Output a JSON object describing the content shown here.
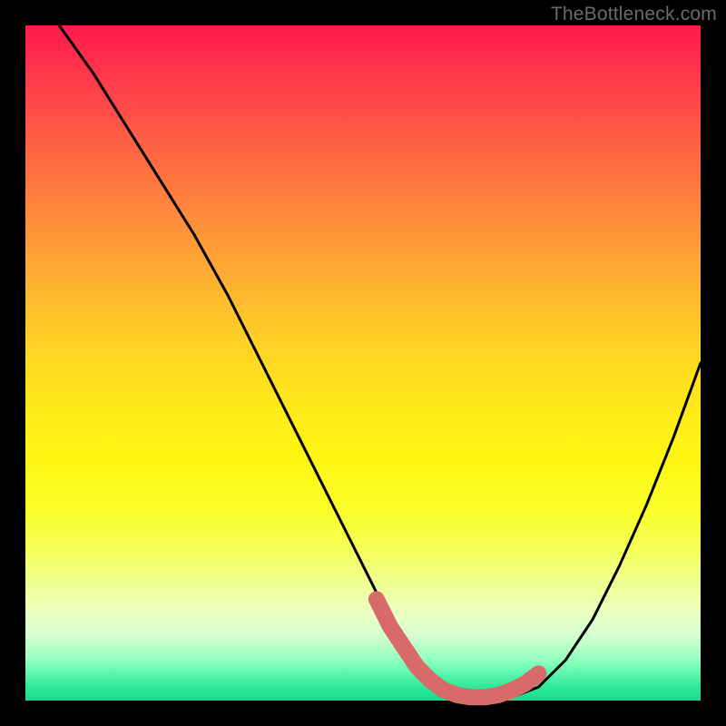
{
  "watermark_text": "TheBottleneck.com",
  "chart_data": {
    "type": "line",
    "title": "",
    "xlabel": "",
    "ylabel": "",
    "xlim": [
      0,
      100
    ],
    "ylim": [
      0,
      100
    ],
    "grid": false,
    "legend": false,
    "annotations": [],
    "series": [
      {
        "name": "bottleneck-curve",
        "color": "#000000",
        "x": [
          5,
          10,
          15,
          20,
          25,
          30,
          35,
          40,
          45,
          50,
          53,
          56,
          59,
          62,
          65,
          68,
          72,
          76,
          80,
          84,
          88,
          92,
          96,
          100
        ],
        "values": [
          100,
          93,
          85,
          77,
          69,
          60,
          50,
          40,
          30,
          20,
          14,
          9,
          5,
          2,
          0.5,
          0.5,
          0.5,
          2,
          6,
          12,
          20,
          29,
          39,
          50
        ]
      },
      {
        "name": "optimum-highlight",
        "color": "#d96a6a",
        "x": [
          52,
          54,
          56,
          58,
          60,
          62,
          64,
          66,
          68,
          70,
          72,
          74,
          76
        ],
        "values": [
          15,
          11,
          8,
          5,
          3,
          1.5,
          0.8,
          0.5,
          0.5,
          0.8,
          1.5,
          2.5,
          4
        ]
      }
    ]
  }
}
